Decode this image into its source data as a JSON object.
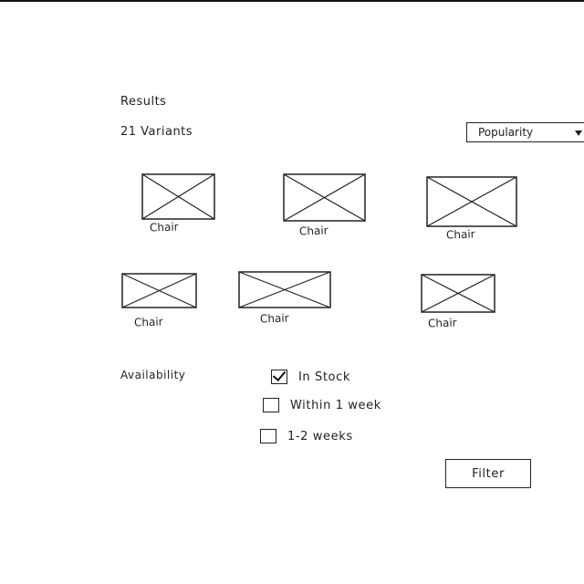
{
  "header": {
    "title": "Results",
    "variant_count": "21 Variants"
  },
  "sort": {
    "selected": "Popularity",
    "caret_icon": "caret-down-icon"
  },
  "products": [
    {
      "label": "Chair",
      "icon": "image-placeholder-icon"
    },
    {
      "label": "Chair",
      "icon": "image-placeholder-icon"
    },
    {
      "label": "Chair",
      "icon": "image-placeholder-icon"
    },
    {
      "label": "Chair",
      "icon": "image-placeholder-icon"
    },
    {
      "label": "Chair",
      "icon": "image-placeholder-icon"
    },
    {
      "label": "Chair",
      "icon": "image-placeholder-icon"
    }
  ],
  "filters": {
    "availability_label": "Availability",
    "options": [
      {
        "label": "In Stock",
        "checked": true
      },
      {
        "label": "Within 1 week",
        "checked": false
      },
      {
        "label": "1-2 weeks",
        "checked": false
      }
    ],
    "button_label": "Filter"
  }
}
